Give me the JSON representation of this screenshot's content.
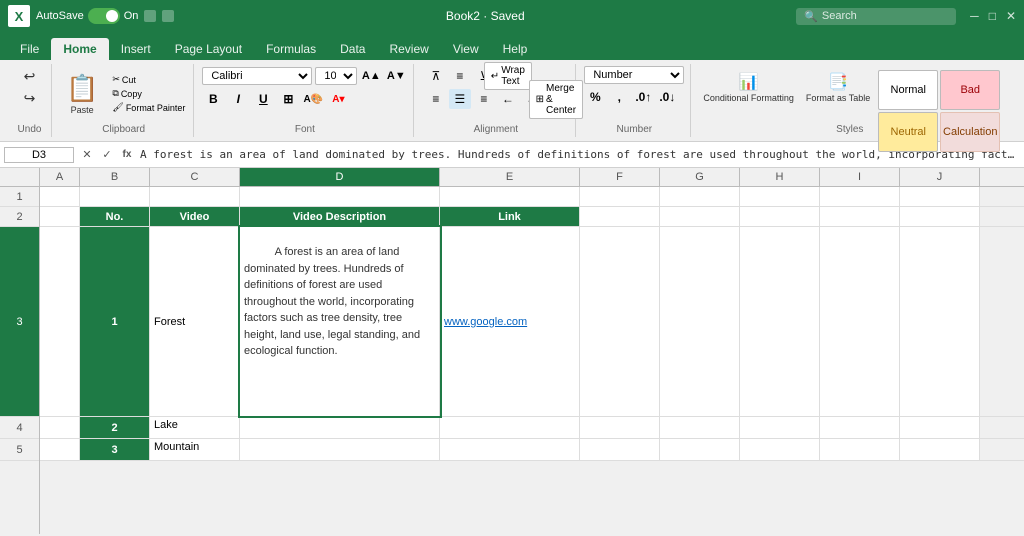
{
  "titlebar": {
    "logo": "X",
    "autosave_label": "AutoSave",
    "toggle_state": "On",
    "filename": "Book2 · Saved",
    "search_placeholder": "Search"
  },
  "ribbon_tabs": {
    "items": [
      "File",
      "Home",
      "Insert",
      "Page Layout",
      "Formulas",
      "Data",
      "Review",
      "View",
      "Help"
    ],
    "active": "Home"
  },
  "ribbon": {
    "undo_label": "Undo",
    "clipboard": {
      "label": "Clipboard",
      "paste_label": "Paste",
      "cut_label": "Cut",
      "copy_label": "Copy",
      "format_painter_label": "Format Painter"
    },
    "font": {
      "label": "Font",
      "font_name": "Calibri",
      "font_size": "10",
      "bold_label": "B",
      "italic_label": "I",
      "underline_label": "U"
    },
    "alignment": {
      "label": "Alignment",
      "wrap_text_label": "Wrap Text",
      "merge_label": "Merge & Center"
    },
    "number": {
      "label": "Number",
      "format": "Number"
    },
    "styles": {
      "label": "Styles",
      "conditional_label": "Conditional Formatting",
      "format_table_label": "Format as Table",
      "normal_label": "Normal",
      "bad_label": "Bad",
      "neutral_label": "Neutral",
      "calculation_label": "Calculation"
    }
  },
  "formula_bar": {
    "name_box": "D3",
    "formula_text": "A forest is an area of land dominated by trees. Hundreds of definitions of forest are used throughout the world, incorporating factors such as tree density, tree height, lan"
  },
  "columns": {
    "headers": [
      "",
      "A",
      "B",
      "C",
      "D",
      "E",
      "F",
      "G",
      "H",
      "I",
      "J"
    ]
  },
  "rows": {
    "row1": {
      "num": "1",
      "cells": [
        "",
        "",
        "",
        "",
        "",
        "",
        "",
        "",
        "",
        ""
      ]
    },
    "row2": {
      "num": "2",
      "cells": [
        "",
        "No.",
        "Video",
        "Video Description",
        "Link",
        "",
        "",
        "",
        "",
        ""
      ]
    },
    "row3": {
      "num": "3",
      "cells": [
        "",
        "1",
        "Forest",
        "A forest is an area of land dominated by trees. Hundreds of definitions of forest are used throughout the world, incorporating factors such as tree density, tree height, land use, legal standing, and ecological function.",
        "www.google.com",
        "",
        "",
        "",
        "",
        ""
      ]
    },
    "row4": {
      "num": "4",
      "cells": [
        "",
        "2",
        "Lake",
        "",
        "",
        "",
        "",
        "",
        "",
        ""
      ]
    },
    "row5": {
      "num": "5",
      "cells": [
        "",
        "3",
        "Mountain",
        "",
        "",
        "",
        "",
        "",
        "",
        ""
      ]
    }
  }
}
